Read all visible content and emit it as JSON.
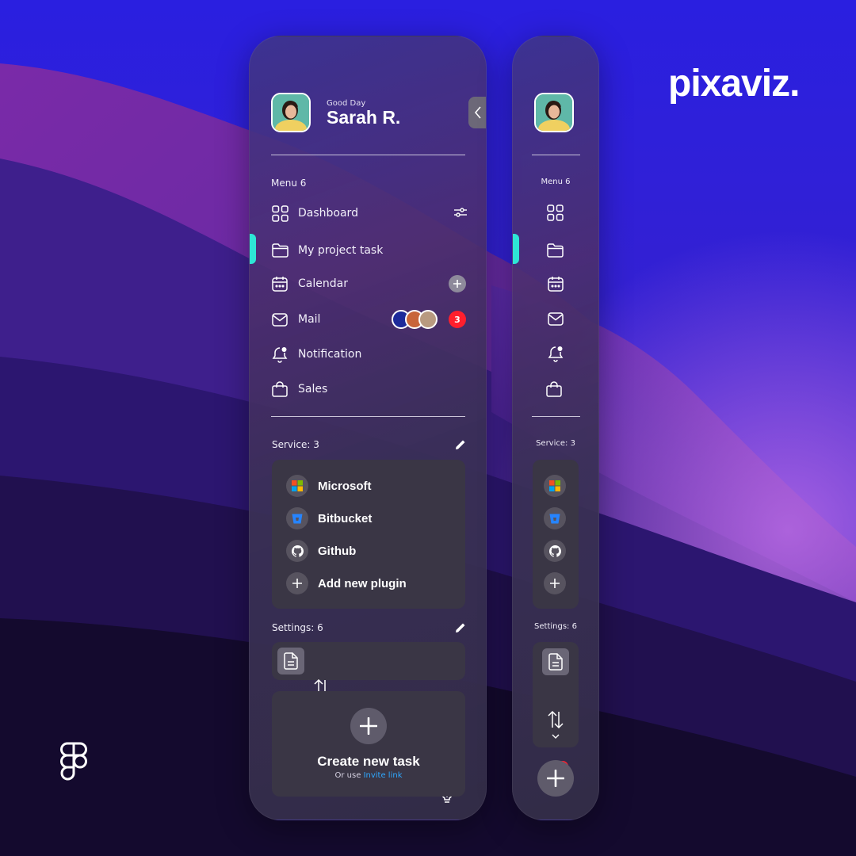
{
  "brand": {
    "logo_text": "pixaviz."
  },
  "colors": {
    "accent_indicator": "#2ee6d6",
    "badge_red": "#ff1f2d",
    "link": "#2fa8ff",
    "card_bg": "#3a3645"
  },
  "sidebar_expanded": {
    "greeting": "Good Day",
    "user_name": "Sarah R.",
    "menu_title": "Menu 6",
    "menu_items": [
      {
        "label": "Dashboard",
        "icon": "grid-icon"
      },
      {
        "label": "My project task",
        "icon": "folder-icon"
      },
      {
        "label": "Calendar",
        "icon": "calendar-icon"
      },
      {
        "label": "Mail",
        "icon": "mail-icon",
        "badge": "3"
      },
      {
        "label": "Notification",
        "icon": "bell-icon"
      },
      {
        "label": "Sales",
        "icon": "bag-icon"
      }
    ],
    "service_title": "Service: 3",
    "services": [
      {
        "label": "Microsoft",
        "icon": "microsoft-icon"
      },
      {
        "label": "Bitbucket",
        "icon": "bitbucket-icon"
      },
      {
        "label": "Github",
        "icon": "github-icon"
      },
      {
        "label": "Add new plugin",
        "icon": "plus-icon"
      }
    ],
    "settings_title": "Settings: 6",
    "settings_badge": "6",
    "create_task": {
      "title": "Create new task",
      "sub_prefix": "Or use ",
      "link": "Invite link"
    }
  },
  "sidebar_collapsed": {
    "menu_title": "Menu 6",
    "service_title": "Service: 3",
    "settings_title": "Settings: 6",
    "settings_badge": "6"
  }
}
